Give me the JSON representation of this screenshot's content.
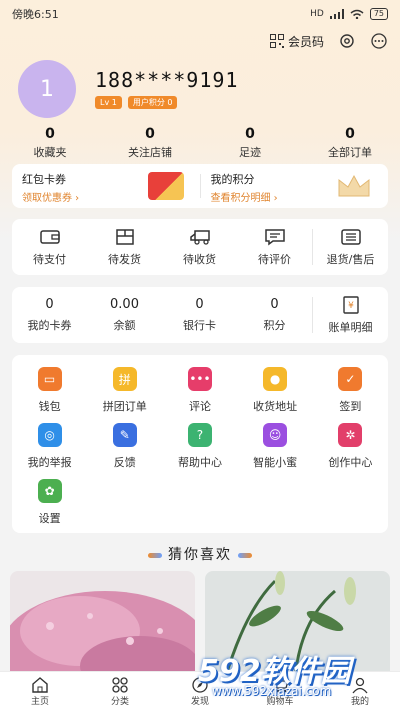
{
  "status_bar": {
    "time": "傍晚6:51",
    "signal": "HD",
    "battery": "75"
  },
  "header": {
    "member_code": "会员码"
  },
  "user": {
    "avatar_text": "1",
    "phone": "188****9191",
    "level": "Lv 1",
    "points_badge": "用户积分 0"
  },
  "stats": [
    {
      "num": "0",
      "label": "收藏夹"
    },
    {
      "num": "0",
      "label": "关注店铺"
    },
    {
      "num": "0",
      "label": "足迹"
    },
    {
      "num": "0",
      "label": "全部订单"
    }
  ],
  "promo": {
    "left": {
      "title": "红包卡券",
      "sub": "领取优惠券 ›"
    },
    "right": {
      "title": "我的积分",
      "sub": "查看积分明细 ›"
    }
  },
  "orders": [
    {
      "label": "待支付",
      "icon": "wallet-icon"
    },
    {
      "label": "待发货",
      "icon": "box-icon"
    },
    {
      "label": "待收货",
      "icon": "truck-icon"
    },
    {
      "label": "待评价",
      "icon": "comment-icon"
    },
    {
      "label": "退货/售后",
      "icon": "return-icon"
    }
  ],
  "wallet": [
    {
      "num": "0",
      "label": "我的卡券"
    },
    {
      "num": "0.00",
      "label": "余额"
    },
    {
      "num": "0",
      "label": "银行卡"
    },
    {
      "num": "0",
      "label": "积分"
    }
  ],
  "bill": {
    "label": "账单明细",
    "icon": "bill-icon"
  },
  "services": [
    {
      "label": "钱包",
      "icon": "wallet-icon",
      "color": "#f07a2e",
      "glyph": "▭"
    },
    {
      "label": "拼团订单",
      "icon": "shopping-bag-icon",
      "color": "#f5b82a",
      "glyph": "拼"
    },
    {
      "label": "评论",
      "icon": "chat-icon",
      "color": "#e63d6a",
      "glyph": "•••"
    },
    {
      "label": "收货地址",
      "icon": "location-icon",
      "color": "#f5b82a",
      "glyph": "●"
    },
    {
      "label": "签到",
      "icon": "calendar-icon",
      "color": "#f07a2e",
      "glyph": "✓"
    },
    {
      "label": "我的举报",
      "icon": "target-icon",
      "color": "#2f8fe8",
      "glyph": "◎"
    },
    {
      "label": "反馈",
      "icon": "document-icon",
      "color": "#3a6fe0",
      "glyph": "✎"
    },
    {
      "label": "帮助中心",
      "icon": "help-icon",
      "color": "#3cb371",
      "glyph": "?"
    },
    {
      "label": "智能小蜜",
      "icon": "smile-icon",
      "color": "#9b4fe0",
      "glyph": "☺"
    },
    {
      "label": "创作中心",
      "icon": "aperture-icon",
      "color": "#e23f6a",
      "glyph": "✲"
    },
    {
      "label": "设置",
      "icon": "flower-gear-icon",
      "color": "#4caf50",
      "glyph": "✿"
    }
  ],
  "guess": {
    "title": "猜你喜欢"
  },
  "tabs": [
    {
      "label": "主页",
      "icon": "home-icon"
    },
    {
      "label": "分类",
      "icon": "category-icon"
    },
    {
      "label": "发现",
      "icon": "discover-icon"
    },
    {
      "label": "购物车",
      "icon": "cart-icon"
    },
    {
      "label": "我的",
      "icon": "user-icon"
    }
  ],
  "watermark": {
    "big": "592软件园",
    "small": "www.592xiazai.com"
  },
  "colors": {
    "accent": "#f08a2a",
    "avatar": "#c9b4ee",
    "top_bg": "#fcefdc"
  }
}
